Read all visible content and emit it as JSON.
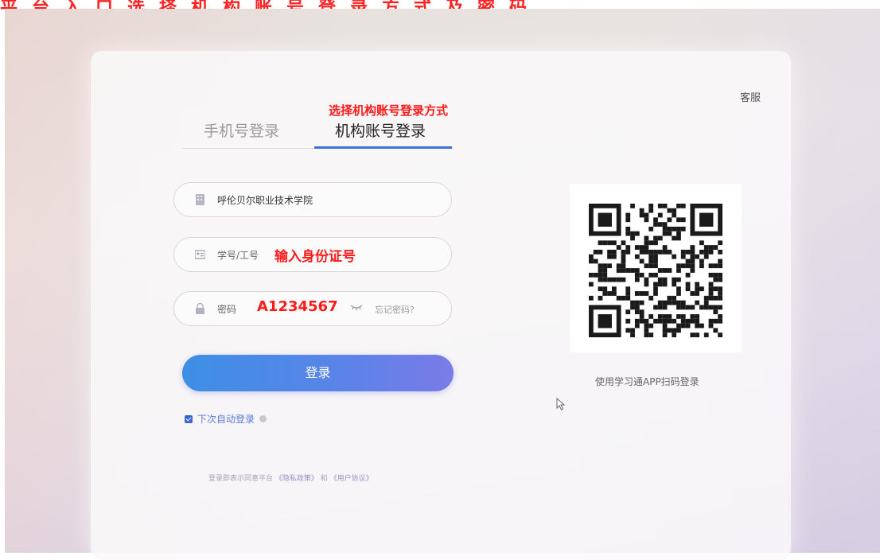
{
  "annotation_banner": "平台入口选择机构账号登录方式及密码",
  "header": {
    "service_label": "客服"
  },
  "tabs": [
    {
      "label": "手机号登录",
      "active": false
    },
    {
      "label": "机构账号登录",
      "active": true
    }
  ],
  "tab_annotation": "选择机构账号登录方式",
  "form": {
    "school": {
      "value": "呼伦贝尔职业技术学院",
      "icon": "building-icon"
    },
    "student_id": {
      "label": "学号/工号",
      "annotation": "输入身份证号",
      "icon": "id-card-icon"
    },
    "password": {
      "label": "密码",
      "annotation": "A1234567",
      "icon": "lock-icon",
      "forgot_label": "忘记密码?"
    },
    "submit_label": "登录",
    "auto_login_label": "下次自动登录"
  },
  "agreement": {
    "prefix": "登录即表示同意平台",
    "privacy": "《隐私政策》",
    "and": "和",
    "terms": "《用户协议》"
  },
  "qr": {
    "caption": "使用学习通APP扫码登录"
  },
  "colors": {
    "accent": "#3b6fd9",
    "annotation": "#ff1a1a",
    "button_start": "#3d8fe6",
    "button_end": "#7a7be6"
  }
}
